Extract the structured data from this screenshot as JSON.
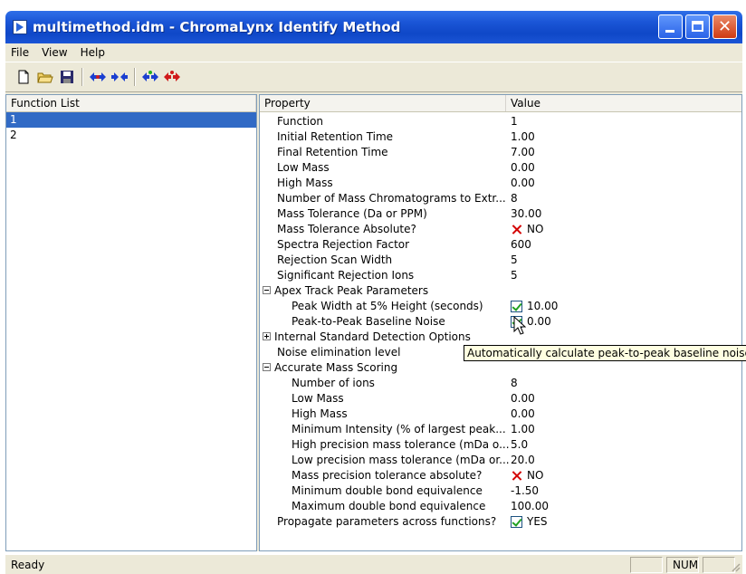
{
  "window": {
    "title": "multimethod.idm - ChromaLynx Identify Method"
  },
  "menu": [
    "File",
    "View",
    "Help"
  ],
  "toolbar": {
    "icons": [
      "new-file-icon",
      "open-folder-icon",
      "save-icon",
      "move-left-right-icon",
      "move-right-left-icon",
      "add-function-icon",
      "remove-function-icon"
    ]
  },
  "function_list": {
    "header": "Function List",
    "items": [
      "1",
      "2"
    ],
    "selected": "1"
  },
  "properties": {
    "header_property": "Property",
    "header_value": "Value",
    "rows": [
      {
        "name": "Function",
        "value": "1",
        "indent": 1
      },
      {
        "name": "Initial Retention Time",
        "value": "1.00",
        "indent": 1
      },
      {
        "name": "Final Retention Time",
        "value": "7.00",
        "indent": 1
      },
      {
        "name": "Low Mass",
        "value": "0.00",
        "indent": 1
      },
      {
        "name": "High Mass",
        "value": "0.00",
        "indent": 1
      },
      {
        "name": "Number of Mass Chromatograms to Extr...",
        "value": "8",
        "indent": 1
      },
      {
        "name": "Mass Tolerance (Da or PPM)",
        "value": "30.00",
        "indent": 1
      },
      {
        "name": "Mass Tolerance Absolute?",
        "value": "NO",
        "check": "no",
        "indent": 1
      },
      {
        "name": "Spectra Rejection Factor",
        "value": "600",
        "indent": 1
      },
      {
        "name": "Rejection Scan Width",
        "value": "5",
        "indent": 1
      },
      {
        "name": "Significant Rejection Ions",
        "value": "5",
        "indent": 1
      },
      {
        "name": "Apex Track Peak Parameters",
        "value": "",
        "group": "minus",
        "indent": 0
      },
      {
        "name": "Peak Width at 5% Height (seconds)",
        "value": "10.00",
        "check": "yes",
        "indent": 2
      },
      {
        "name": "Peak-to-Peak Baseline Noise",
        "value": "0.00",
        "check": "yes",
        "indent": 2
      },
      {
        "name": "Internal Standard Detection Options",
        "value": "",
        "group": "plus",
        "indent": 0
      },
      {
        "name": "Noise elimination level",
        "value": "",
        "indent": 1
      },
      {
        "name": "Accurate Mass Scoring",
        "value": "",
        "group": "minus",
        "indent": 0
      },
      {
        "name": "Number of ions",
        "value": "8",
        "indent": 2
      },
      {
        "name": "Low Mass",
        "value": "0.00",
        "indent": 2
      },
      {
        "name": "High Mass",
        "value": "0.00",
        "indent": 2
      },
      {
        "name": "Minimum Intensity (% of largest peak...",
        "value": "1.00",
        "indent": 2
      },
      {
        "name": "High precision mass tolerance (mDa o...",
        "value": "5.0",
        "indent": 2
      },
      {
        "name": "Low precision mass tolerance (mDa or...",
        "value": "20.0",
        "indent": 2
      },
      {
        "name": "Mass precision tolerance absolute?",
        "value": "NO",
        "check": "no",
        "indent": 2
      },
      {
        "name": "Minimum double bond equivalence",
        "value": "-1.50",
        "indent": 2
      },
      {
        "name": "Maximum double bond equivalence",
        "value": "100.00",
        "indent": 2
      },
      {
        "name": "Propagate parameters across functions?",
        "value": "YES",
        "check": "yes",
        "indent": 1
      }
    ]
  },
  "tooltip": "Automatically calculate peak-to-peak baseline noise?",
  "status": {
    "text": "Ready",
    "num": "NUM"
  }
}
